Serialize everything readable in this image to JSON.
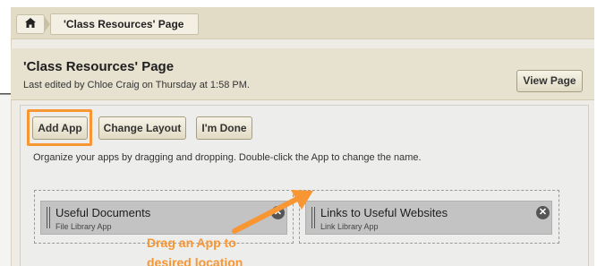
{
  "breadcrumb": {
    "home_icon": "home-icon",
    "current_page": "'Class Resources' Page"
  },
  "header": {
    "title": "'Class Resources' Page",
    "subtitle": "Last edited by Chloe Craig on Thursday at 1:58 PM.",
    "view_page_label": "View Page"
  },
  "toolbar": {
    "add_app_label": "Add App",
    "change_layout_label": "Change Layout",
    "done_label": "I'm Done"
  },
  "instructions": "Organize your apps by dragging and dropping. Double-click the App to change the name.",
  "apps": [
    {
      "title": "Useful Documents",
      "subtitle": "File Library App"
    },
    {
      "title": "Links to Useful Websites",
      "subtitle": "Link Library App"
    }
  ],
  "annotation": {
    "line1": "Drag an App to",
    "line2": "desired location",
    "color": "#f79633"
  },
  "colors": {
    "accent": "#f79633",
    "header_bg": "#e7e2d0",
    "app_card": "#c3c3c3"
  }
}
